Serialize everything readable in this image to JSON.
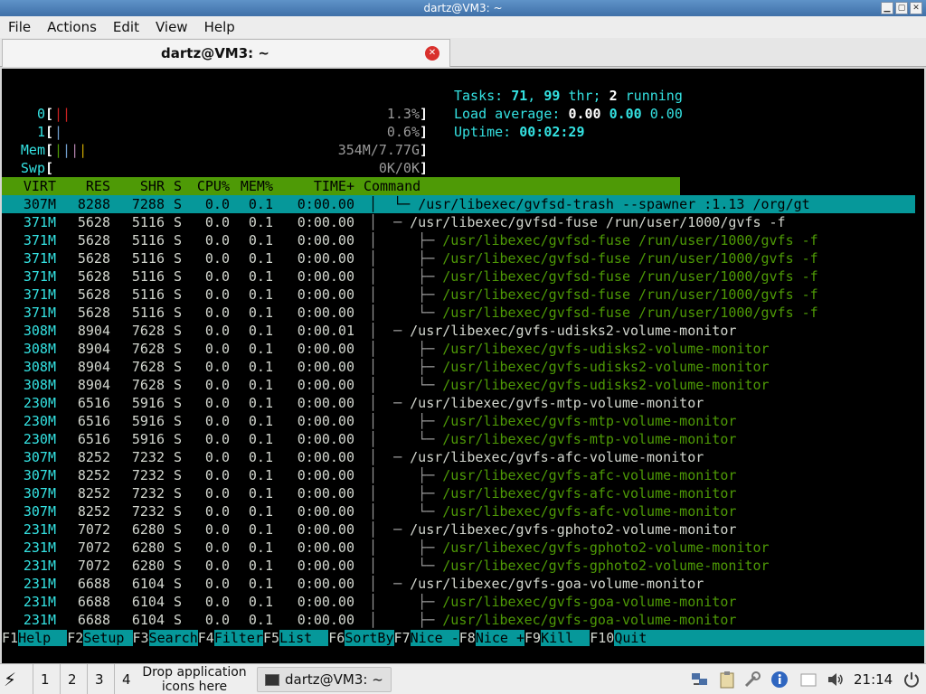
{
  "window": {
    "title": "dartz@VM3: ~"
  },
  "menu": {
    "file": "File",
    "actions": "Actions",
    "edit": "Edit",
    "view": "View",
    "help": "Help"
  },
  "tab": {
    "label": "dartz@VM3: ~"
  },
  "htop": {
    "cpu0": {
      "label": "0",
      "bar": "||",
      "pct": "1.3%"
    },
    "cpu1": {
      "label": "1",
      "bar": "|",
      "pct": "0.6%"
    },
    "mem": {
      "label": "Mem",
      "bar": "||||",
      "val": "354M/7.77G"
    },
    "swp": {
      "label": "Swp",
      "val": "0K/0K"
    },
    "tasks": {
      "label": "Tasks:",
      "procs": "71",
      "sep": ",",
      "threads": "99",
      "thr": "thr;",
      "running": "2",
      "running_label": "running"
    },
    "load": {
      "label": "Load average:",
      "l1": "0.00",
      "l5": "0.00",
      "l15": "0.00"
    },
    "uptime": {
      "label": "Uptime:",
      "value": "00:02:29"
    },
    "header": {
      "virt": "VIRT",
      "res": "RES",
      "shr": "SHR",
      "s": "S",
      "cpu": "CPU%",
      "mem": "MEM%",
      "time": "TIME+",
      "command": "Command"
    },
    "rows": [
      {
        "virt": "307M",
        "res": "8288",
        "shr": "7288",
        "s": "S",
        "cpu": "0.0",
        "mem": "0.1",
        "time": "0:00.00",
        "tree": "│  └─ ",
        "cmd": "/usr/libexec/gvfsd-trash --spawner :1.13 /org/gt",
        "child": true
      },
      {
        "virt": "371M",
        "res": "5628",
        "shr": "5116",
        "s": "S",
        "cpu": "0.0",
        "mem": "0.1",
        "time": "0:00.00",
        "tree": "│  ─ ",
        "cmd": "/usr/libexec/gvfsd-fuse /run/user/1000/gvfs -f",
        "child": false
      },
      {
        "virt": "371M",
        "res": "5628",
        "shr": "5116",
        "s": "S",
        "cpu": "0.0",
        "mem": "0.1",
        "time": "0:00.00",
        "tree": "│     ├─ ",
        "cmd": "/usr/libexec/gvfsd-fuse /run/user/1000/gvfs -f",
        "child": true
      },
      {
        "virt": "371M",
        "res": "5628",
        "shr": "5116",
        "s": "S",
        "cpu": "0.0",
        "mem": "0.1",
        "time": "0:00.00",
        "tree": "│     ├─ ",
        "cmd": "/usr/libexec/gvfsd-fuse /run/user/1000/gvfs -f",
        "child": true
      },
      {
        "virt": "371M",
        "res": "5628",
        "shr": "5116",
        "s": "S",
        "cpu": "0.0",
        "mem": "0.1",
        "time": "0:00.00",
        "tree": "│     ├─ ",
        "cmd": "/usr/libexec/gvfsd-fuse /run/user/1000/gvfs -f",
        "child": true
      },
      {
        "virt": "371M",
        "res": "5628",
        "shr": "5116",
        "s": "S",
        "cpu": "0.0",
        "mem": "0.1",
        "time": "0:00.00",
        "tree": "│     ├─ ",
        "cmd": "/usr/libexec/gvfsd-fuse /run/user/1000/gvfs -f",
        "child": true
      },
      {
        "virt": "371M",
        "res": "5628",
        "shr": "5116",
        "s": "S",
        "cpu": "0.0",
        "mem": "0.1",
        "time": "0:00.00",
        "tree": "│     └─ ",
        "cmd": "/usr/libexec/gvfsd-fuse /run/user/1000/gvfs -f",
        "child": true
      },
      {
        "virt": "308M",
        "res": "8904",
        "shr": "7628",
        "s": "S",
        "cpu": "0.0",
        "mem": "0.1",
        "time": "0:00.01",
        "tree": "│  ─ ",
        "cmd": "/usr/libexec/gvfs-udisks2-volume-monitor",
        "child": false
      },
      {
        "virt": "308M",
        "res": "8904",
        "shr": "7628",
        "s": "S",
        "cpu": "0.0",
        "mem": "0.1",
        "time": "0:00.00",
        "tree": "│     ├─ ",
        "cmd": "/usr/libexec/gvfs-udisks2-volume-monitor",
        "child": true
      },
      {
        "virt": "308M",
        "res": "8904",
        "shr": "7628",
        "s": "S",
        "cpu": "0.0",
        "mem": "0.1",
        "time": "0:00.00",
        "tree": "│     ├─ ",
        "cmd": "/usr/libexec/gvfs-udisks2-volume-monitor",
        "child": true
      },
      {
        "virt": "308M",
        "res": "8904",
        "shr": "7628",
        "s": "S",
        "cpu": "0.0",
        "mem": "0.1",
        "time": "0:00.00",
        "tree": "│     └─ ",
        "cmd": "/usr/libexec/gvfs-udisks2-volume-monitor",
        "child": true
      },
      {
        "virt": "230M",
        "res": "6516",
        "shr": "5916",
        "s": "S",
        "cpu": "0.0",
        "mem": "0.1",
        "time": "0:00.00",
        "tree": "│  ─ ",
        "cmd": "/usr/libexec/gvfs-mtp-volume-monitor",
        "child": false
      },
      {
        "virt": "230M",
        "res": "6516",
        "shr": "5916",
        "s": "S",
        "cpu": "0.0",
        "mem": "0.1",
        "time": "0:00.00",
        "tree": "│     ├─ ",
        "cmd": "/usr/libexec/gvfs-mtp-volume-monitor",
        "child": true
      },
      {
        "virt": "230M",
        "res": "6516",
        "shr": "5916",
        "s": "S",
        "cpu": "0.0",
        "mem": "0.1",
        "time": "0:00.00",
        "tree": "│     └─ ",
        "cmd": "/usr/libexec/gvfs-mtp-volume-monitor",
        "child": true
      },
      {
        "virt": "307M",
        "res": "8252",
        "shr": "7232",
        "s": "S",
        "cpu": "0.0",
        "mem": "0.1",
        "time": "0:00.00",
        "tree": "│  ─ ",
        "cmd": "/usr/libexec/gvfs-afc-volume-monitor",
        "child": false
      },
      {
        "virt": "307M",
        "res": "8252",
        "shr": "7232",
        "s": "S",
        "cpu": "0.0",
        "mem": "0.1",
        "time": "0:00.00",
        "tree": "│     ├─ ",
        "cmd": "/usr/libexec/gvfs-afc-volume-monitor",
        "child": true
      },
      {
        "virt": "307M",
        "res": "8252",
        "shr": "7232",
        "s": "S",
        "cpu": "0.0",
        "mem": "0.1",
        "time": "0:00.00",
        "tree": "│     ├─ ",
        "cmd": "/usr/libexec/gvfs-afc-volume-monitor",
        "child": true
      },
      {
        "virt": "307M",
        "res": "8252",
        "shr": "7232",
        "s": "S",
        "cpu": "0.0",
        "mem": "0.1",
        "time": "0:00.00",
        "tree": "│     └─ ",
        "cmd": "/usr/libexec/gvfs-afc-volume-monitor",
        "child": true
      },
      {
        "virt": "231M",
        "res": "7072",
        "shr": "6280",
        "s": "S",
        "cpu": "0.0",
        "mem": "0.1",
        "time": "0:00.00",
        "tree": "│  ─ ",
        "cmd": "/usr/libexec/gvfs-gphoto2-volume-monitor",
        "child": false
      },
      {
        "virt": "231M",
        "res": "7072",
        "shr": "6280",
        "s": "S",
        "cpu": "0.0",
        "mem": "0.1",
        "time": "0:00.00",
        "tree": "│     ├─ ",
        "cmd": "/usr/libexec/gvfs-gphoto2-volume-monitor",
        "child": true
      },
      {
        "virt": "231M",
        "res": "7072",
        "shr": "6280",
        "s": "S",
        "cpu": "0.0",
        "mem": "0.1",
        "time": "0:00.00",
        "tree": "│     └─ ",
        "cmd": "/usr/libexec/gvfs-gphoto2-volume-monitor",
        "child": true
      },
      {
        "virt": "231M",
        "res": "6688",
        "shr": "6104",
        "s": "S",
        "cpu": "0.0",
        "mem": "0.1",
        "time": "0:00.00",
        "tree": "│  ─ ",
        "cmd": "/usr/libexec/gvfs-goa-volume-monitor",
        "child": false
      },
      {
        "virt": "231M",
        "res": "6688",
        "shr": "6104",
        "s": "S",
        "cpu": "0.0",
        "mem": "0.1",
        "time": "0:00.00",
        "tree": "│     ├─ ",
        "cmd": "/usr/libexec/gvfs-goa-volume-monitor",
        "child": true
      },
      {
        "virt": "231M",
        "res": "6688",
        "shr": "6104",
        "s": "S",
        "cpu": "0.0",
        "mem": "0.1",
        "time": "0:00.00",
        "tree": "│     ├─ ",
        "cmd": "/usr/libexec/gvfs-goa-volume-monitor",
        "child": true
      }
    ],
    "fkeys": [
      {
        "key": "F1",
        "label": "Help  "
      },
      {
        "key": "F2",
        "label": "Setup "
      },
      {
        "key": "F3",
        "label": "Search"
      },
      {
        "key": "F4",
        "label": "Filter"
      },
      {
        "key": "F5",
        "label": "List  "
      },
      {
        "key": "F6",
        "label": "SortBy"
      },
      {
        "key": "F7",
        "label": "Nice -"
      },
      {
        "key": "F8",
        "label": "Nice +"
      },
      {
        "key": "F9",
        "label": "Kill  "
      },
      {
        "key": "F10",
        "label": "Quit                                          "
      }
    ]
  },
  "taskbar": {
    "ws1": "1",
    "ws2": "2",
    "ws3": "3",
    "ws4": "4",
    "drop_line1": "Drop application",
    "drop_line2": "icons here",
    "task_label": "dartz@VM3: ~",
    "clock": "21:14"
  },
  "colors": {
    "htop_green": "#4e9a06",
    "htop_cyan": "#06989a",
    "tab_close": "#d9302c"
  }
}
